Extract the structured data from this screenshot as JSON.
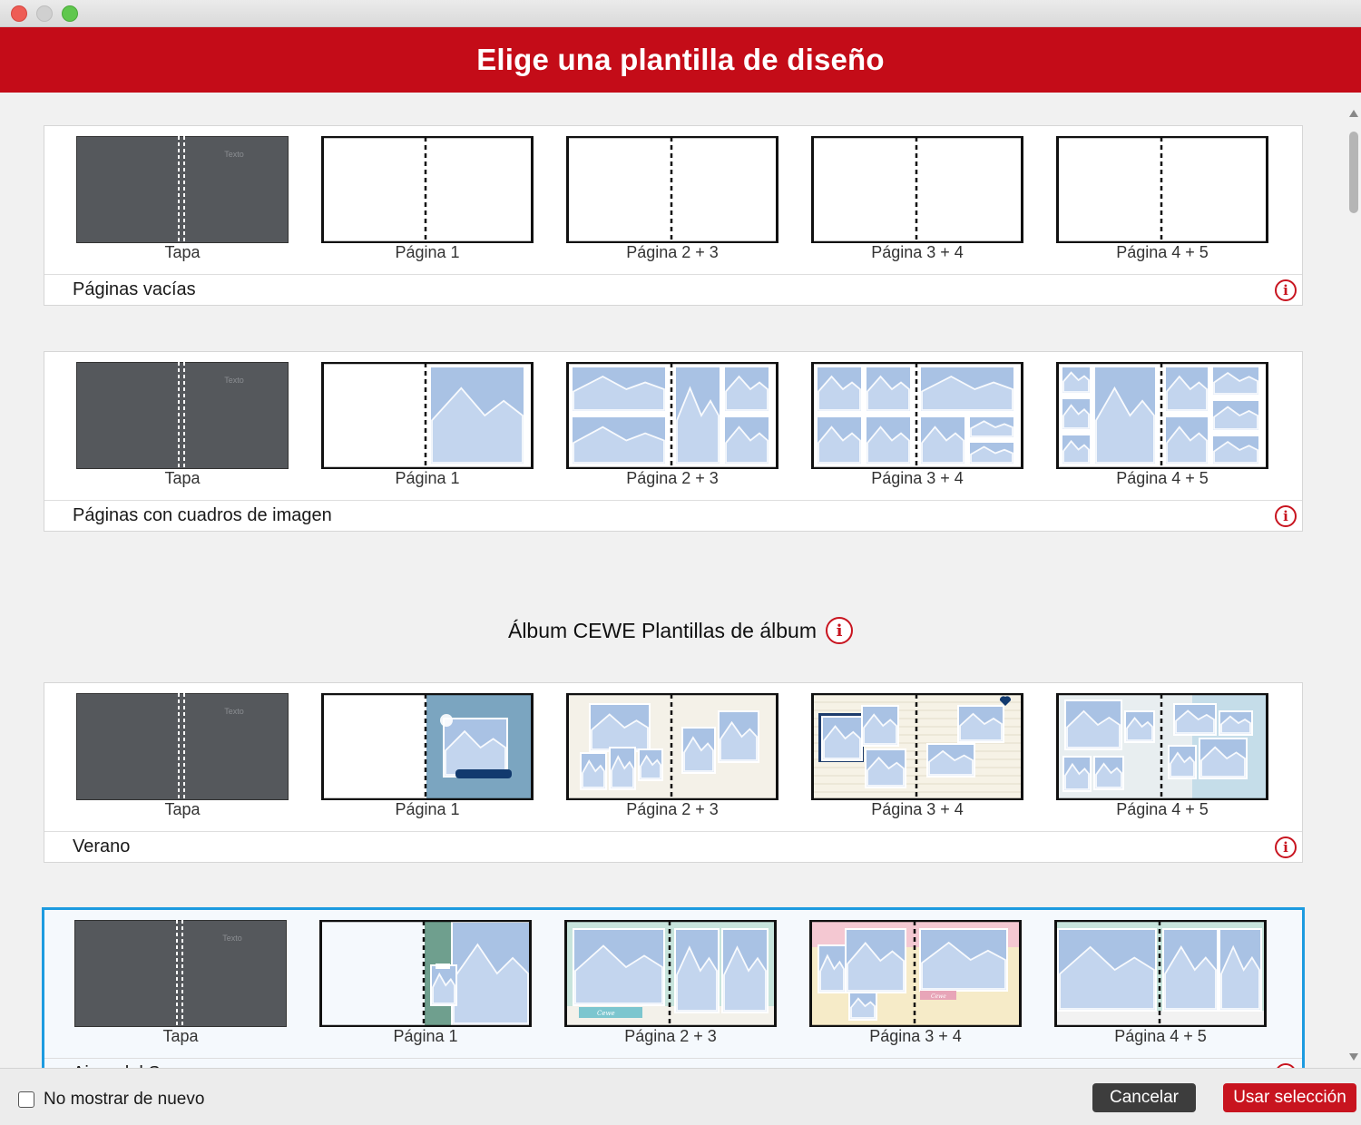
{
  "dialog": {
    "title": "Elige una plantilla de diseño"
  },
  "section_heading": {
    "title": "Álbum CEWE Plantillas de álbum"
  },
  "thumb_labels": [
    "Tapa",
    "Página 1",
    "Página 2 + 3",
    "Página 3 + 4",
    "Página 4 + 5"
  ],
  "cover_text": "Texto",
  "sticker_text": "Cewe",
  "templates": [
    {
      "name": "Páginas vacías",
      "style": "blank"
    },
    {
      "name": "Páginas con cuadros de imagen",
      "style": "frames"
    },
    {
      "name": "Verano",
      "style": "verano"
    },
    {
      "name": "Aires del Sur",
      "style": "aires",
      "selected": true
    }
  ],
  "info_glyph": "i",
  "footer": {
    "dont_show_again": "No mostrar de nuevo",
    "dont_show_checked": false,
    "cancel": "Cancelar",
    "use_selection": "Usar selección"
  },
  "colors": {
    "header_red": "#c40c18",
    "accent_red": "#c8141f",
    "selection_blue": "#1d9be0",
    "cover_gray": "#55585c",
    "photo_placeholder": "#a9c2e4",
    "verano_blue": "#7ba5c0",
    "aires_teal": "#c7e4dc",
    "aires_pink": "#f4c8d2"
  },
  "icons": {
    "info": "info-circle-icon",
    "checkbox": "checkbox-icon",
    "scroll_up": "scroll-up-arrow-icon",
    "scroll_down": "scroll-down-arrow-icon"
  }
}
